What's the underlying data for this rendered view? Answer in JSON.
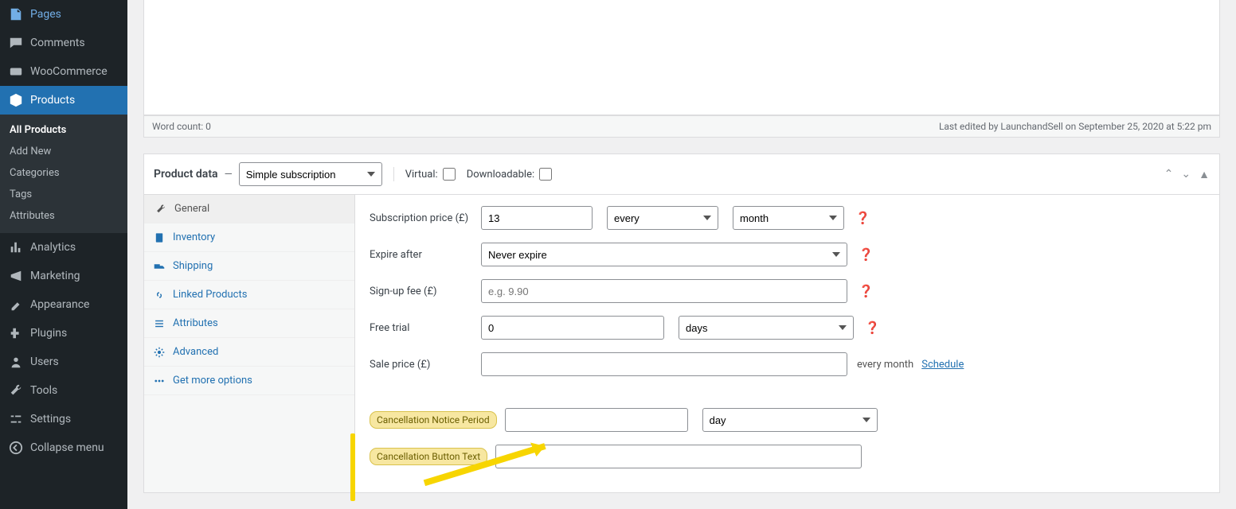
{
  "sidebar": {
    "pages": "Pages",
    "comments": "Comments",
    "woocommerce": "WooCommerce",
    "products": "Products",
    "sub": {
      "all": "All Products",
      "add": "Add New",
      "cat": "Categories",
      "tags": "Tags",
      "attr": "Attributes"
    },
    "analytics": "Analytics",
    "marketing": "Marketing",
    "appearance": "Appearance",
    "plugins": "Plugins",
    "users": "Users",
    "tools": "Tools",
    "settings": "Settings",
    "collapse": "Collapse menu"
  },
  "editor": {
    "word_count": "Word count: 0",
    "last_edited": "Last edited by LaunchandSell on September 25, 2020 at 5:22 pm"
  },
  "panel": {
    "title": "Product data",
    "dash": "—",
    "type": "Simple subscription",
    "virtual": "Virtual:",
    "downloadable": "Downloadable:"
  },
  "tabs": {
    "general": "General",
    "inventory": "Inventory",
    "shipping": "Shipping",
    "linked": "Linked Products",
    "attributes": "Attributes",
    "advanced": "Advanced",
    "more": "Get more options"
  },
  "fields": {
    "sub_price_label": "Subscription price (£)",
    "sub_price_value": "13",
    "sub_every": "every",
    "sub_period": "month",
    "expire_label": "Expire after",
    "expire_value": "Never expire",
    "signup_label": "Sign-up fee (£)",
    "signup_placeholder": "e.g. 9.90",
    "trial_label": "Free trial",
    "trial_value": "0",
    "trial_unit": "days",
    "sale_label": "Sale price (£)",
    "sale_after": "every month",
    "schedule": "Schedule",
    "cancel_notice_label": "Cancellation Notice Period",
    "cancel_notice_unit": "day",
    "cancel_btn_label": "Cancellation Button Text"
  }
}
